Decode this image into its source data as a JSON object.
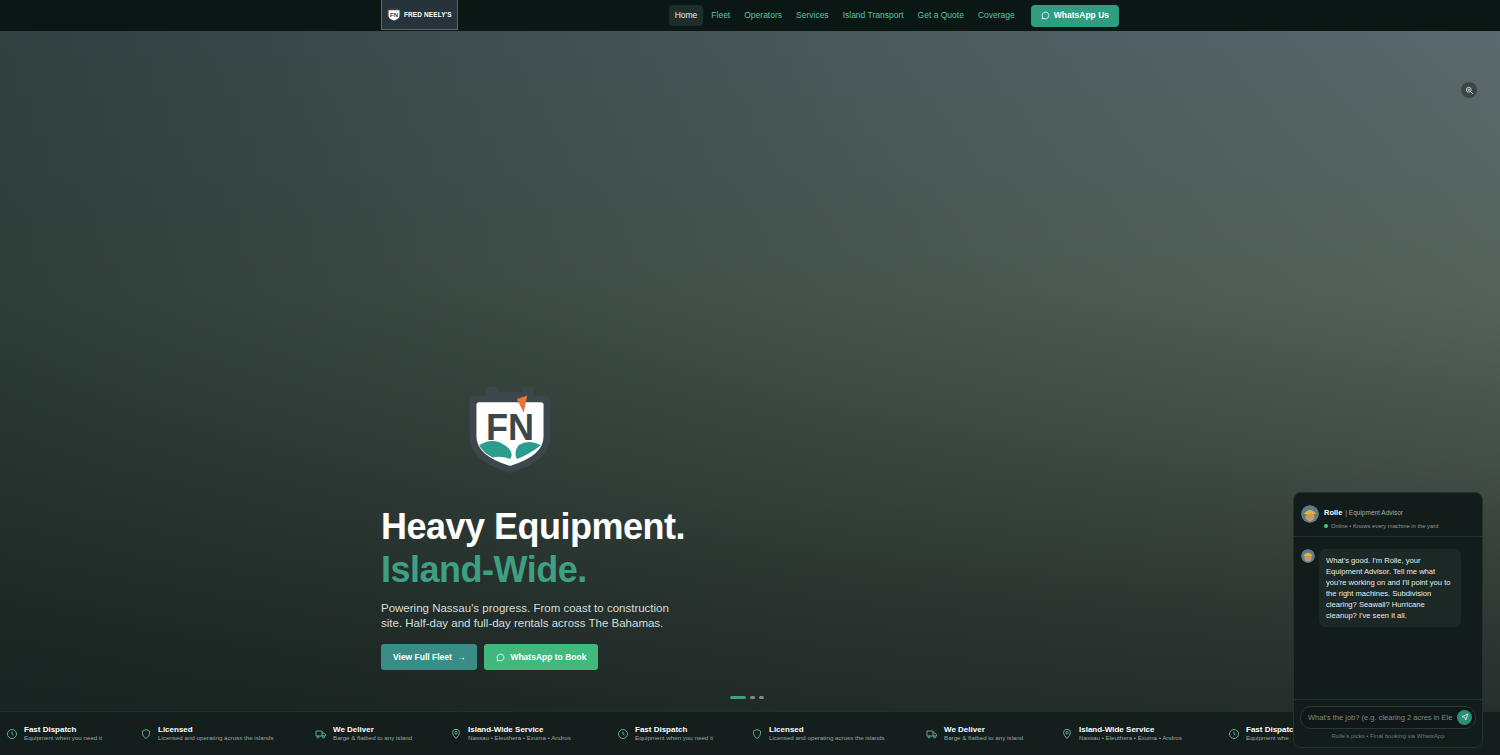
{
  "brand": {
    "emblem": "FN",
    "name": "FRED NEELY'S"
  },
  "nav": {
    "items": [
      {
        "label": "Home",
        "selected": true
      },
      {
        "label": "Fleet",
        "selected": false
      },
      {
        "label": "Operators",
        "selected": false
      },
      {
        "label": "Services",
        "selected": false
      },
      {
        "label": "Island Transport",
        "selected": false
      },
      {
        "label": "Get a Quote",
        "selected": false
      },
      {
        "label": "Coverage",
        "selected": false
      }
    ],
    "cta": "WhatsApp Us"
  },
  "hero": {
    "emblem": "FN",
    "title": "Heavy Equipment.",
    "highlight": "Island-Wide.",
    "subtitle": "Powering Nassau's progress. From coast to construction site. Half-day and full-day rentals across The Bahamas.",
    "primary_button": {
      "label": "View Full Fleet",
      "arrow": "→"
    },
    "whatsapp_button": {
      "label": "WhatsApp to Book"
    },
    "slides": [
      {
        "selected": true
      },
      {
        "selected": false
      },
      {
        "selected": false
      }
    ]
  },
  "features": [
    {
      "kind": "clock",
      "title": "Fast Dispatch",
      "text": "Equipment when you need it"
    },
    {
      "kind": "shield",
      "title": "Licensed",
      "text": "Licensed and operating across the islands"
    },
    {
      "kind": "truck",
      "title": "We Deliver",
      "text": "Barge & flatbed to any island"
    },
    {
      "kind": "pin",
      "title": "Island-Wide Service",
      "text": "Nassau • Eleuthera • Exuma • Andros"
    },
    {
      "kind": "clock",
      "title": "Fast Dispatch",
      "text": "Equipment when you need it"
    },
    {
      "kind": "shield",
      "title": "Licensed",
      "text": "Licensed and operating across the islands"
    },
    {
      "kind": "truck",
      "title": "We Deliver",
      "text": "Barge & flatbed to any island"
    },
    {
      "kind": "pin",
      "title": "Island-Wide Service",
      "text": "Nassau • Eleuthera • Exuma • Andros"
    },
    {
      "kind": "clock",
      "title": "Fast Dispatch",
      "text": "Equipment whe"
    }
  ],
  "chat": {
    "name": "Rolle",
    "role": "| Equipment Advisor",
    "status": "Online • Knows every machine in the yard",
    "online": true,
    "messages": [
      {
        "kind": "bot",
        "text": "What's good. I'm Rolle, your Equipment Advisor. Tell me what you're working on and I'll point you to the right machines. Subdivision clearing? Seawall? Hurricane cleanup? I've seen it all."
      }
    ],
    "input_placeholder": "What's the job? (e.g. clearing 2 acres in Ele",
    "footer": "Rolle's picks • Final booking via WhatsApp"
  }
}
